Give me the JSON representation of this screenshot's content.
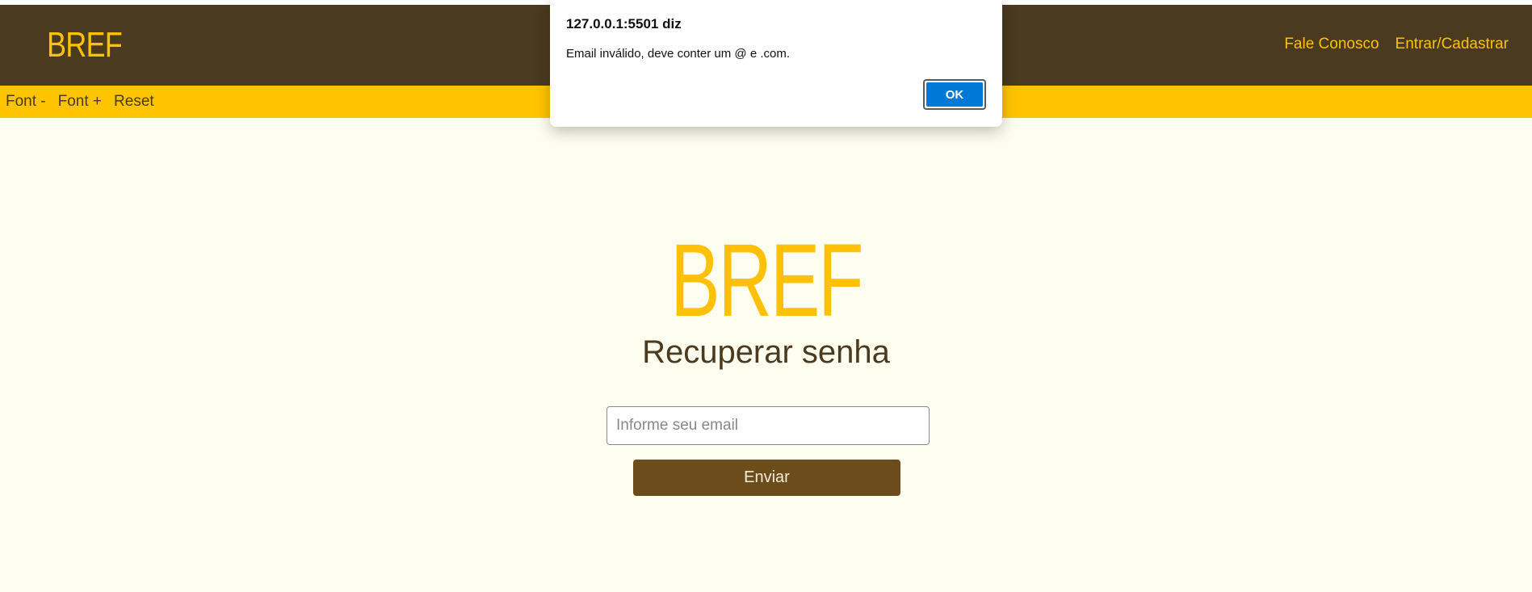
{
  "header": {
    "logo": "BREF",
    "nav": {
      "contact": "Fale Conosco",
      "login": "Entrar/Cadastrar"
    }
  },
  "toolbar": {
    "font_decrease": "Font -",
    "font_increase": "Font +",
    "reset": "Reset"
  },
  "main": {
    "logo": "BREF",
    "title": "Recuperar senha",
    "email_placeholder": "Informe seu email",
    "submit_label": "Enviar"
  },
  "dialog": {
    "title": "127.0.0.1:5501 diz",
    "message": "Email inválido, deve conter um @ e .com.",
    "ok_label": "OK"
  },
  "colors": {
    "header_bg": "#4a3a1f",
    "accent": "#ffc107",
    "toolbar_bg": "#ffc400",
    "page_bg": "#fefef0",
    "button_bg": "#6b4c1a",
    "dialog_ok": "#0078d7"
  }
}
